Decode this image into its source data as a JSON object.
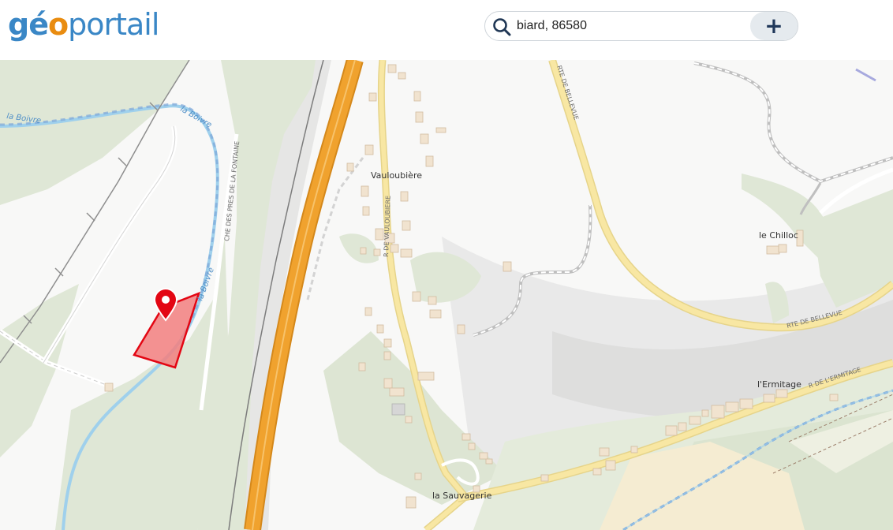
{
  "header": {
    "logo": {
      "part1": "gé",
      "part2": "o",
      "part3": "portail"
    },
    "search": {
      "value": "biard, 86580",
      "add_label": "+"
    }
  },
  "map": {
    "places": {
      "vauloubiere": "Vauloubière",
      "chilloc": "le Chilloc",
      "ermitage": "l'Ermitage",
      "sauvagerie": "la Sauvagerie"
    },
    "roads": {
      "rte_bellevue_top": "RTE DE BELLEVUE",
      "rte_bellevue_bottom": "RTE DE BELLEVUE",
      "r_vauloubiere": "R DE VAULOUBIERE",
      "che_pres_fontaine": "CHE DES PRES DE LA FONTAINE",
      "r_ermitage": "R DE L'ERMITAGE"
    },
    "water": {
      "boivre_1": "la Boivre",
      "boivre_2": "la Boivre",
      "boivre_3": "la Boivre"
    },
    "colors": {
      "forest": "#dfe7d6",
      "motorway": "#f0a22e",
      "main_road": "#f8e7a3",
      "river": "#9fd0ec",
      "parcel": "#f27f7f",
      "marker": "#e30613",
      "farmland": "#f5ecd2"
    }
  }
}
